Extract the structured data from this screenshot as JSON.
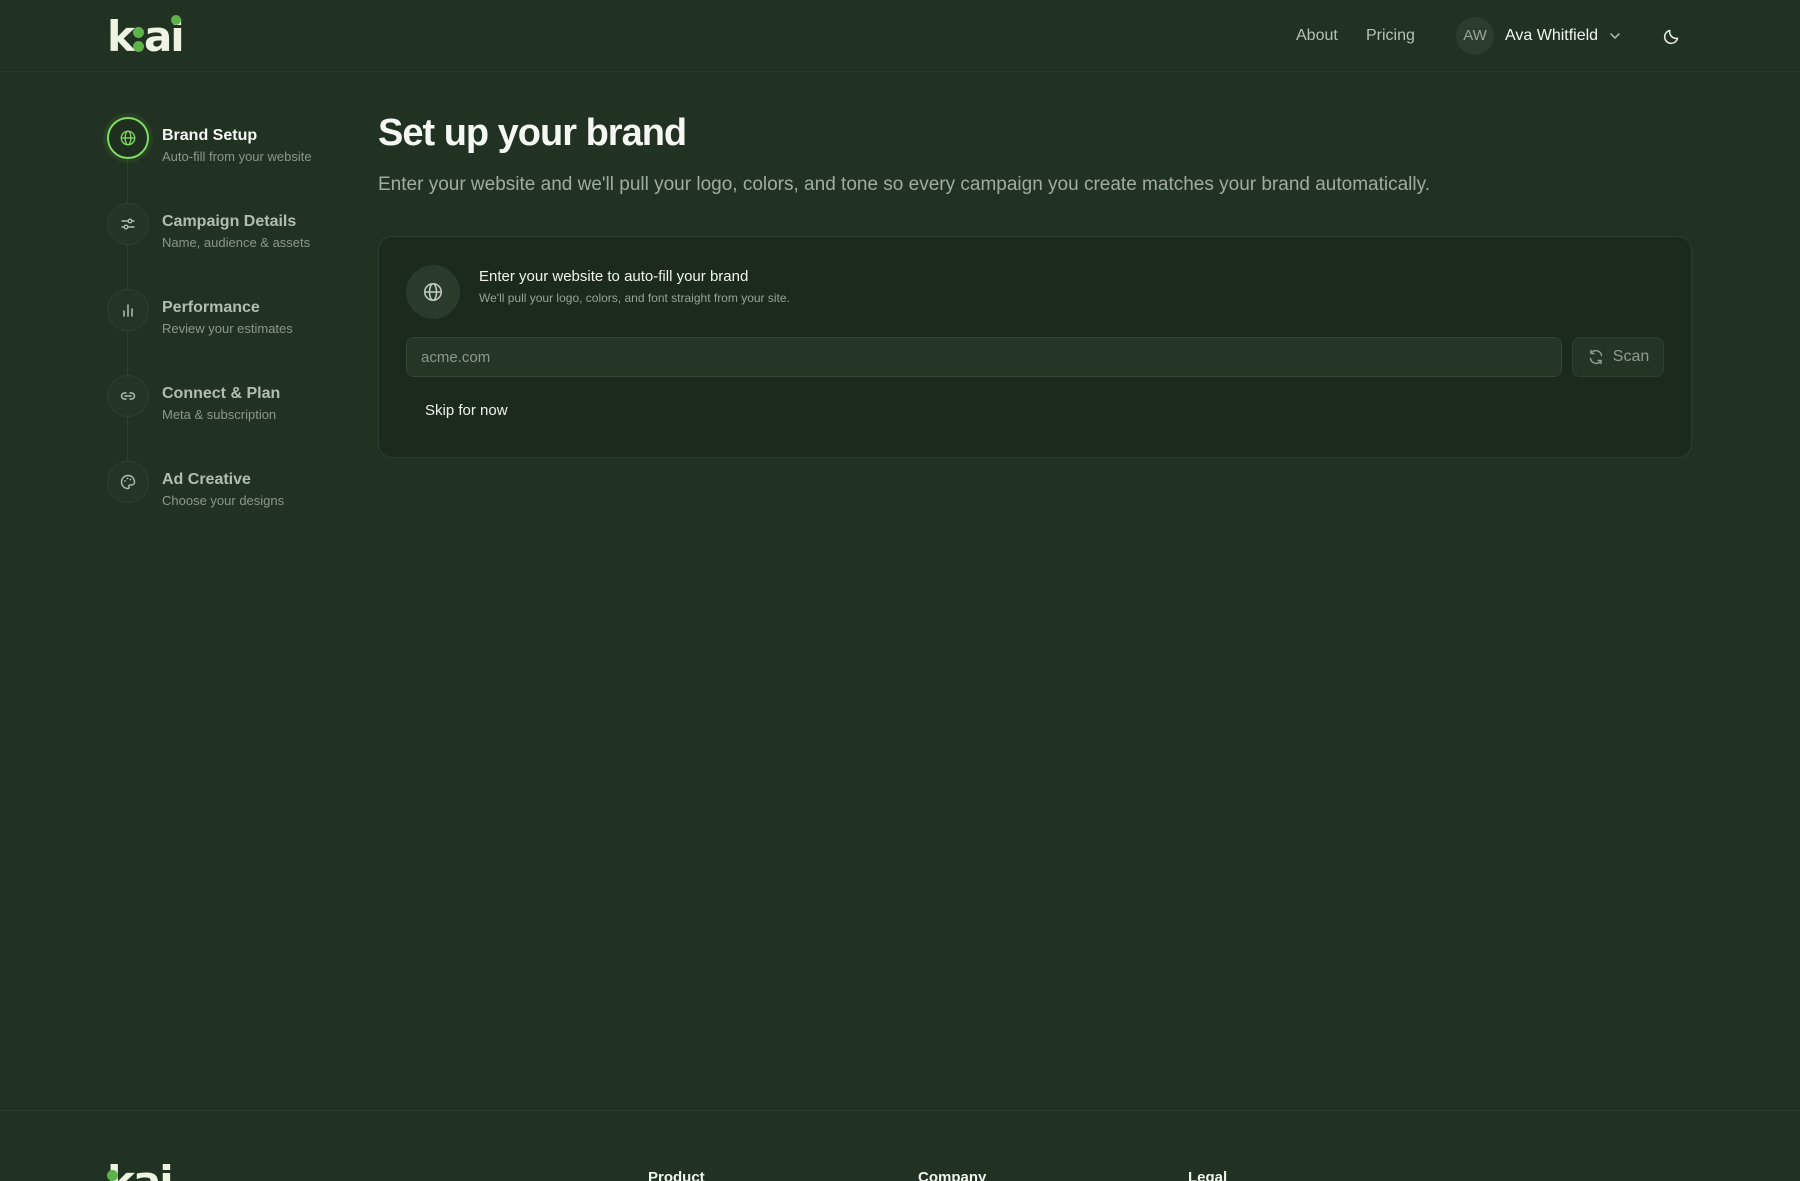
{
  "brand": {
    "logo_text": "k:ai",
    "accent": "#7fdc5e",
    "logo_dot": "#5eb24a"
  },
  "header": {
    "nav": [
      {
        "label": "About"
      },
      {
        "label": "Pricing"
      }
    ],
    "user": {
      "initials": "AW",
      "name": "Ava Whitfield"
    },
    "theme_toggle_icon": "moon-icon"
  },
  "steps": [
    {
      "title": "Brand Setup",
      "subtitle": "Auto-fill from your website",
      "icon": "globe-icon",
      "active": true
    },
    {
      "title": "Campaign Details",
      "subtitle": "Name, audience & assets",
      "icon": "sliders-icon",
      "active": false
    },
    {
      "title": "Performance",
      "subtitle": "Review your estimates",
      "icon": "bar-chart-icon",
      "active": false
    },
    {
      "title": "Connect & Plan",
      "subtitle": "Meta & subscription",
      "icon": "link-icon",
      "active": false
    },
    {
      "title": "Ad Creative",
      "subtitle": "Choose your designs",
      "icon": "palette-icon",
      "active": false
    }
  ],
  "main": {
    "title": "Set up your brand",
    "subtitle": "Enter your website and we'll pull your logo, colors, and tone so every campaign you create matches your brand automatically.",
    "card": {
      "title": "Enter your website to auto-fill your brand",
      "subtitle": "We'll pull your logo, colors, and font straight from your site.",
      "input_placeholder": "acme.com",
      "scan_label": "Scan",
      "skip_label": "Skip for now"
    }
  },
  "footer": {
    "columns": [
      {
        "label": "Product"
      },
      {
        "label": "Company"
      },
      {
        "label": "Legal"
      }
    ]
  }
}
